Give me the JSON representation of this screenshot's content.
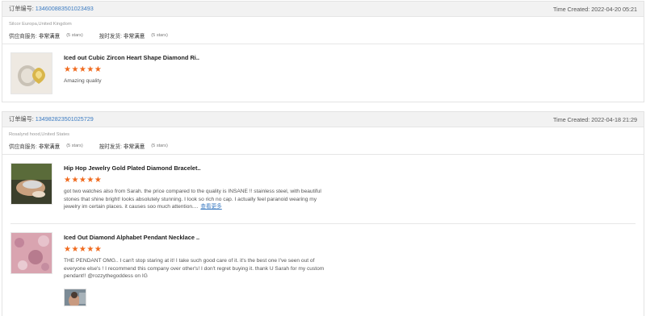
{
  "orders": [
    {
      "order_label": "订单编号:",
      "order_number": "134600883501023493",
      "time_created": "Time Created: 2022-04-20 05:21",
      "buyer": "Silcor Europa,United Kingdom",
      "supplier_service_label": "供应商服务:",
      "supplier_service_value": "非常满意",
      "supplier_service_stars": "(5 stars)",
      "ontime_label": "按时发货:",
      "ontime_value": "非常满意",
      "ontime_stars": "(5 stars)",
      "items": [
        {
          "title": "Iced out Cubic Zircon Heart Shape Diamond Ri..",
          "stars": "★★★★★",
          "rating": 5,
          "review": "Amazing quality"
        }
      ]
    },
    {
      "order_label": "订单编号:",
      "order_number": "134982823501025729",
      "time_created": "Time Created: 2022-04-18 21:29",
      "buyer": "Rosalynd hood,United States",
      "supplier_service_label": "供应商服务:",
      "supplier_service_value": "非常满意",
      "supplier_service_stars": "(5 stars)",
      "ontime_label": "按时发货:",
      "ontime_value": "非常满意",
      "ontime_stars": "(5 stars)",
      "items": [
        {
          "title": "Hip Hop Jewelry Gold Plated Diamond Bracelet..",
          "stars": "★★★★★",
          "rating": 5,
          "review": "got two watches also from Sarah. the price compared to the quality is INSANE !! stainless steel, with beautiful stones that shine bright! looks absolutely stunning. I look so rich no cap. I actually feel paranoid wearing my jewelry im certain places. it causes soo much attention....",
          "more": "查看更多"
        },
        {
          "title": "Iced Out Diamond Alphabet Pendant Necklace ..",
          "stars": "★★★★★",
          "rating": 5,
          "review": "THE PENDANT OMG.. I can't stop staring at it! I take such good care of it. it's the best one I've seen out of everyone else's ! I recommend this company over other's! I don't regret buying it. thank U Sarah for my custom pendant!! @rozzythegoddess on IG"
        }
      ]
    }
  ],
  "colors": {
    "accent": "#3b7bc2",
    "star": "#f06a1e",
    "header_bg": "#f2f2f2"
  }
}
